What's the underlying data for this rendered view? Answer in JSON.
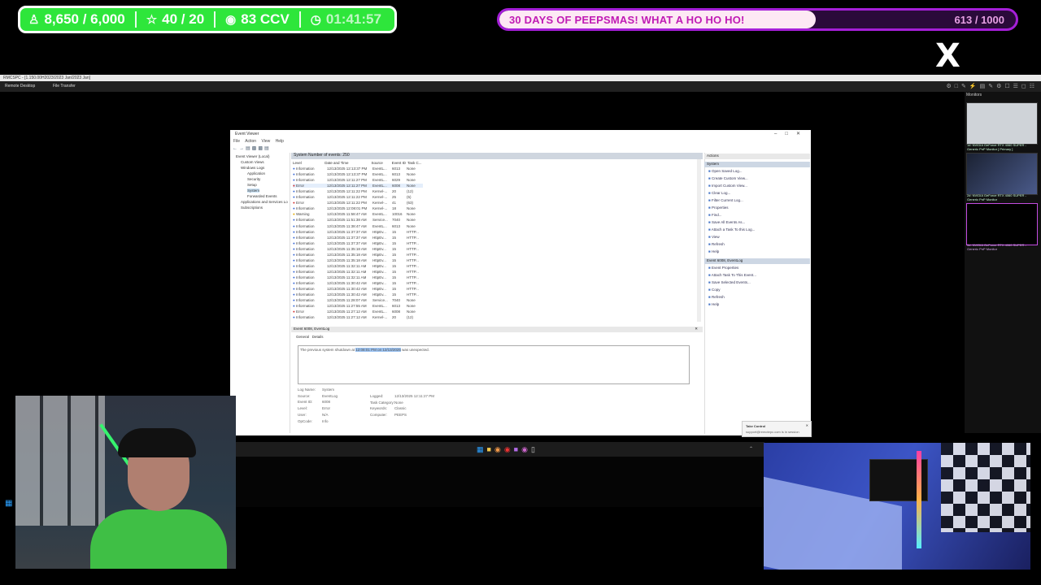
{
  "overlay": {
    "stats": {
      "followers": "8,650 / 6,000",
      "subs": "40 / 20",
      "viewers": "83 CCV",
      "timer": "01:41:57"
    },
    "goal": {
      "title": "30 DAYS OF PEEPSMAS! WHAT A HO HO HO!",
      "count": "613 / 1000",
      "progress": 0.613
    },
    "x_logo": "X"
  },
  "remote_desktop": {
    "title": "RMCSPC - [1.150.00H2023/2023 Jan/2023 Jan]",
    "tabs": [
      "Remote Desktop",
      "File Transfer"
    ],
    "monitors_label": "Monitors",
    "monitors": [
      {
        "caption": "1#: NVIDIA GeForce RTX 4060 SUPER - Generic PnP Monitor [ Primary ]"
      },
      {
        "caption": "2#: NVIDIA GeForce RTX 4060 SUPER - Generic PnP Monitor"
      },
      {
        "caption": "3#: NVIDIA GeForce RTX 4060 SUPER - Generic PnP Monitor"
      }
    ]
  },
  "event_viewer": {
    "title": "Event Viewer",
    "menu": [
      "File",
      "Action",
      "View",
      "Help"
    ],
    "tree": [
      "Event Viewer (Local)",
      "Custom Views",
      "Windows Logs",
      "Application",
      "Security",
      "Setup",
      "System",
      "Forwarded Events",
      "Applications and Services Lo",
      "Subscriptions"
    ],
    "list_header": "System    Number of events: 250",
    "columns": [
      "Level",
      "Date and Time",
      "Source",
      "Event ID",
      "Task C..."
    ],
    "rows": [
      [
        "Information",
        "12/13/2025 12:13:37 PM",
        "EventL...",
        "6013",
        "None"
      ],
      [
        "Information",
        "12/13/2025 12:13:37 PM",
        "EventL...",
        "6013",
        "None"
      ],
      [
        "Information",
        "12/13/2025 12:11:27 PM",
        "EventL...",
        "6029",
        "None"
      ],
      [
        "Error",
        "12/13/2025 12:11:27 PM",
        "EventL...",
        "6008",
        "None"
      ],
      [
        "Information",
        "12/13/2025 12:11:22 PM",
        "Kernel-...",
        "20",
        "(12)"
      ],
      [
        "Information",
        "12/13/2025 12:11:22 PM",
        "Kernel-...",
        "25",
        "(5)"
      ],
      [
        "Error",
        "12/13/2025 12:11:22 PM",
        "Kernel-...",
        "41",
        "(63)"
      ],
      [
        "Information",
        "12/13/2025 12:08:01 PM",
        "Kernel-...",
        "18",
        "None"
      ],
      [
        "Warning",
        "12/13/2025 11:58:47 AM",
        "EventL...",
        "10016",
        "None"
      ],
      [
        "Information",
        "12/13/2025 11:51:38 AM",
        "Service...",
        "7040",
        "None"
      ],
      [
        "Information",
        "12/13/2025 11:38:47 AM",
        "EventL...",
        "6013",
        "None"
      ],
      [
        "Information",
        "12/13/2025 11:37:37 AM",
        "HttpEv...",
        "15",
        "HTTP..."
      ],
      [
        "Information",
        "12/13/2025 11:37:37 AM",
        "HttpEv...",
        "15",
        "HTTP..."
      ],
      [
        "Information",
        "12/13/2025 11:37:37 AM",
        "HttpEv...",
        "15",
        "HTTP..."
      ],
      [
        "Information",
        "12/13/2025 11:35:18 AM",
        "HttpEv...",
        "15",
        "HTTP..."
      ],
      [
        "Information",
        "12/13/2025 11:35:18 AM",
        "HttpEv...",
        "15",
        "HTTP..."
      ],
      [
        "Information",
        "12/13/2025 11:35:18 AM",
        "HttpEv...",
        "15",
        "HTTP..."
      ],
      [
        "Information",
        "12/13/2025 11:32:11 AM",
        "HttpEv...",
        "15",
        "HTTP..."
      ],
      [
        "Information",
        "12/13/2025 11:32:11 AM",
        "HttpEv...",
        "15",
        "HTTP..."
      ],
      [
        "Information",
        "12/13/2025 11:32:11 AM",
        "HttpEv...",
        "15",
        "HTTP..."
      ],
      [
        "Information",
        "12/13/2025 11:30:42 AM",
        "HttpEv...",
        "15",
        "HTTP..."
      ],
      [
        "Information",
        "12/13/2025 11:30:42 AM",
        "HttpEv...",
        "15",
        "HTTP..."
      ],
      [
        "Information",
        "12/13/2025 11:30:42 AM",
        "HttpEv...",
        "15",
        "HTTP..."
      ],
      [
        "Information",
        "12/13/2025 11:28:07 AM",
        "Service...",
        "7040",
        "None"
      ],
      [
        "Information",
        "12/13/2025 11:27:55 AM",
        "EventL...",
        "6013",
        "None"
      ],
      [
        "Error",
        "12/13/2025 11:27:12 AM",
        "EventL...",
        "6008",
        "None"
      ],
      [
        "Information",
        "12/13/2025 11:27:12 AM",
        "Kernel-...",
        "20",
        "(12)"
      ]
    ],
    "detail_title": "Event 6008, EventLog",
    "detail_tabs": [
      "General",
      "Details"
    ],
    "message_pre": "The previous system shutdown at ",
    "message_highlight": "12:08:01 PM on 12/13/2025",
    "message_post": " was unexpected.",
    "props": {
      "log_name_label": "Log Name:",
      "log_name": "System",
      "source_label": "Source:",
      "source": "EventLog",
      "event_id_label": "Event ID:",
      "event_id": "6008",
      "level_label": "Level:",
      "level": "Error",
      "user_label": "User:",
      "user": "N/A",
      "opcode_label": "OpCode:",
      "opcode": "Info",
      "logged_label": "Logged:",
      "logged": "12/13/2025 12:11:27 PM",
      "task_label": "Task Category:",
      "task": "None",
      "keywords_label": "Keywords:",
      "keywords": "Classic",
      "computer_label": "Computer:",
      "computer": "PEEPS"
    },
    "actions": {
      "header": "Actions",
      "section1": "System",
      "section1_items": [
        "Open Saved Log...",
        "Create Custom View...",
        "Import Custom View...",
        "Clear Log...",
        "Filter Current Log...",
        "Properties",
        "Find...",
        "Save All Events As...",
        "Attach a Task To this Log...",
        "View",
        "Refresh",
        "Help"
      ],
      "section2": "Event 6008, EventLog",
      "section2_items": [
        "Event Properties",
        "Attach Task To This Event...",
        "Save Selected Events...",
        "Copy",
        "Refresh",
        "Help"
      ]
    },
    "toast": {
      "title": "Take Control",
      "body": "support@remotepc.com is in session"
    }
  }
}
